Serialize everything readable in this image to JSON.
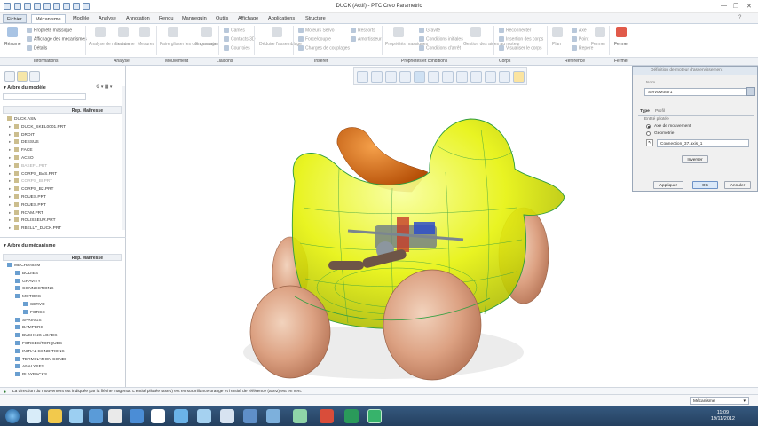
{
  "title": "DUCK (Actif) - PTC Creo Parametric",
  "tabs": [
    "Fichier",
    "Mécanisme",
    "Modèle",
    "Analyse",
    "Annotation",
    "Rendu",
    "Mannequin",
    "Outils",
    "Affichage",
    "Applications",
    "Structure"
  ],
  "ribbon": {
    "resume_label": "Résumé",
    "info_items": [
      "Propriété massique",
      "Affichage des mécanismes",
      "Détails"
    ],
    "analysis_items": [
      "Analyse de mécanisme",
      "Lecture",
      "Mesures"
    ],
    "movement_items": [
      "Faire glisser les composants",
      "Engrenages"
    ],
    "connection_items": [
      "Cames",
      "Contacts 3D",
      "Courroies"
    ],
    "liaison_items": [
      "Déduire l'assemblage"
    ],
    "insert_items": [
      "Moteurs Servo",
      "Force/couple",
      "Charges de couplages"
    ],
    "insert_items2": [
      "Ressorts",
      "Amortisseurs"
    ],
    "props_items": [
      "Propriétés massiques"
    ],
    "props_items2": [
      "Gravité",
      "Conditions initiales",
      "Conditions d'arrêt"
    ],
    "props_items3": [
      "Gestion des aides au moteur",
      "Mesures"
    ],
    "body_items": [
      "Reconnecter",
      "Insertion des corps",
      "Visualiser le corps"
    ],
    "ref_items": [
      "Plan",
      "Axe",
      "Point",
      "Repère"
    ],
    "quit_label": "Fermer",
    "close_label": "Fermer",
    "groups": [
      "Informations",
      "Analyse",
      "Mouvement",
      "Liaisons",
      "Insérer",
      "Propriétés et conditions",
      "Corps",
      "Référence",
      "Fermer"
    ]
  },
  "model_tree": {
    "title": "Arbre du modèle",
    "column": "Rep. Maîtresse",
    "items": [
      {
        "label": "DUCK.ASM",
        "gray": false
      },
      {
        "label": "DUCK_SKEL0001.PRT",
        "gray": false
      },
      {
        "label": "DROIT",
        "gray": false
      },
      {
        "label": "DESSUS",
        "gray": false
      },
      {
        "label": "FACE",
        "gray": false
      },
      {
        "label": "ACSO",
        "gray": false
      },
      {
        "label": "BASEFL.PRT",
        "gray": true
      },
      {
        "label": "CORPS_BAS.PRT",
        "gray": false
      },
      {
        "label": "CORPS_BI.PRT",
        "gray": true
      },
      {
        "label": "CORPS_B2.PRT",
        "gray": false
      },
      {
        "label": "ROUES.PRT",
        "gray": false
      },
      {
        "label": "ROUES.PRT",
        "gray": false
      },
      {
        "label": "RCAM.PRT",
        "gray": false
      },
      {
        "label": "ROLISSEUR.PRT",
        "gray": false
      },
      {
        "label": "RBELLY_DUCK.PRT",
        "gray": false
      }
    ]
  },
  "mech_tree": {
    "title": "Arbre du mécanisme",
    "column": "Rep. Maîtresse",
    "items": [
      {
        "label": "MECHANISM",
        "indent": 0
      },
      {
        "label": "BODIES",
        "indent": 1
      },
      {
        "label": "GRAVITY",
        "indent": 1
      },
      {
        "label": "CONNECTIONS",
        "indent": 1
      },
      {
        "label": "MOTORS",
        "indent": 1
      },
      {
        "label": "SERVO",
        "indent": 2
      },
      {
        "label": "FORCE",
        "indent": 2
      },
      {
        "label": "SPRINGS",
        "indent": 1
      },
      {
        "label": "DAMPERS",
        "indent": 1
      },
      {
        "label": "BUSHING LOADS",
        "indent": 1
      },
      {
        "label": "FORCES/TORQUES",
        "indent": 1
      },
      {
        "label": "INITIAL CONDITIONS",
        "indent": 1
      },
      {
        "label": "TERMINATION CONDI",
        "indent": 1
      },
      {
        "label": "ANALYSES",
        "indent": 1
      },
      {
        "label": "PLAYBACKS",
        "indent": 1
      }
    ]
  },
  "dialog": {
    "title": "Définition de moteur d'asservissement",
    "name_label": "Nom",
    "name_value": "ServoMotor1",
    "tab_type": "Type",
    "tab_profile": "Profil",
    "driven_label": "Entité pilotée",
    "radio1": "Axe de mouvement",
    "radio2": "Géométrie",
    "connection_value": "Connection_37.axis_1",
    "inverse_button": "Inverser",
    "apply_button": "Appliquer",
    "ok_button": "OK",
    "cancel_button": "Annuler"
  },
  "message": "La direction du mouvement est indiquée par la flèche magenta. L'entité pilotée (axe1) est en surbrillance orange et l'entité de référence (axe2) est en vert.",
  "status": {
    "mode": "Mécanisme"
  },
  "clock": {
    "time": "11:09",
    "date": "19/11/2012"
  }
}
